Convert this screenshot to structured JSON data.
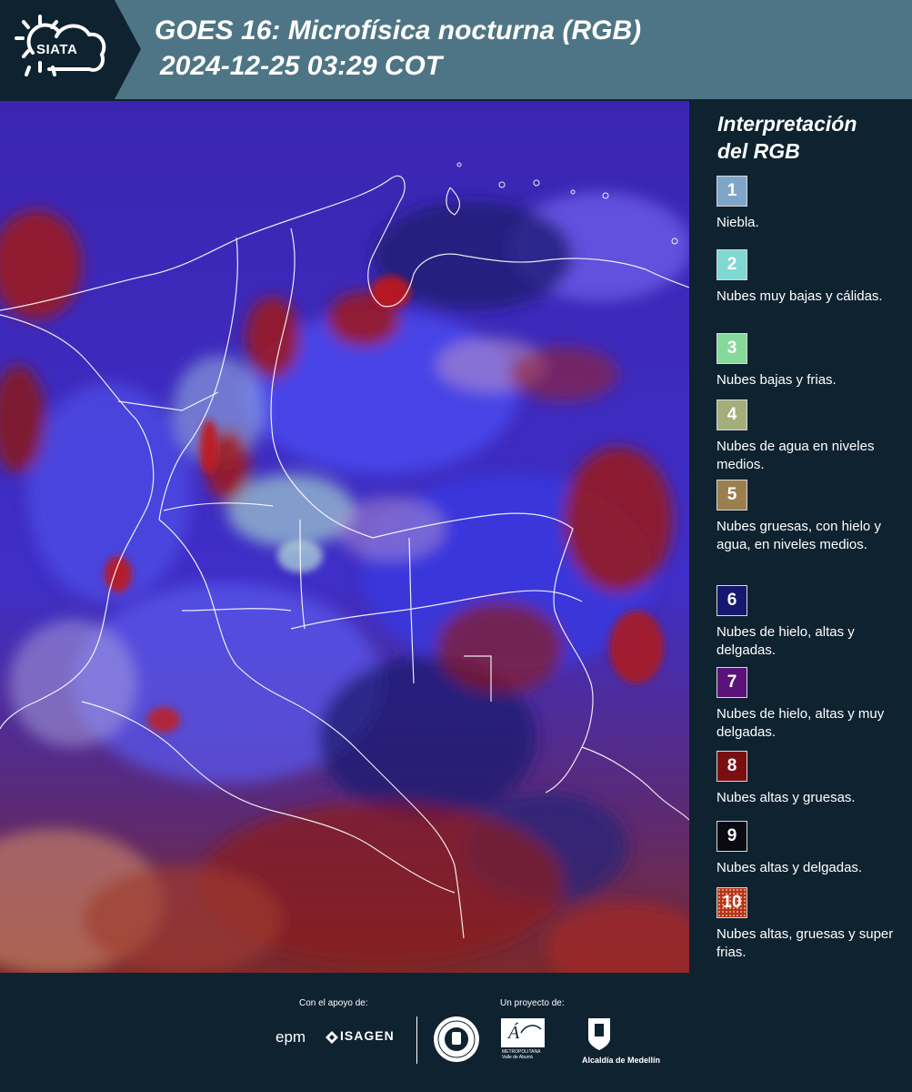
{
  "header": {
    "logo_text": "SIATA",
    "title_line1": "GOES 16: Microfísica nocturna (RGB)",
    "title_line2": "2024-12-25 03:29 COT"
  },
  "colors": {
    "header_bg": "#4e7585",
    "panel_bg": "#0f2230",
    "map_base": "#3a2bb8"
  },
  "legend": {
    "title_line1": "Interpretación",
    "title_line2": "del RGB",
    "items": [
      {
        "num": "1",
        "color": "#7fa6c9",
        "text": "Niebla."
      },
      {
        "num": "2",
        "color": "#7fd8d2",
        "text": "Nubes muy bajas y cálidas."
      },
      {
        "num": "3",
        "color": "#86d99a",
        "text": "Nubes bajas y frias."
      },
      {
        "num": "4",
        "color": "#a3ae7a",
        "text": "Nubes de agua en niveles medios."
      },
      {
        "num": "5",
        "color": "#9b7f4f",
        "text": "Nubes gruesas, con hielo y agua, en niveles medios."
      },
      {
        "num": "6",
        "color": "#16186f",
        "text": "Nubes de hielo, altas y delgadas."
      },
      {
        "num": "7",
        "color": "#5a1378",
        "text": "Nubes de hielo, altas y muy delgadas."
      },
      {
        "num": "8",
        "color": "#7a0f12",
        "text": "Nubes altas y gruesas."
      },
      {
        "num": "9",
        "color": "#0a0a12",
        "text": "Nubes altas y delgadas."
      },
      {
        "num": "10",
        "color": "#b4331c",
        "text": "Nubes altas, gruesas y super frias."
      }
    ]
  },
  "footer": {
    "support_label": "Con el apoyo de:",
    "project_label": "Un proyecto de:",
    "epm": "epm",
    "isagen": "ISAGEN",
    "metropolitana_1": "METROPOLITANA",
    "metropolitana_2": "Valle de Aburrá",
    "alcaldia": "Alcaldía de Medellín"
  }
}
